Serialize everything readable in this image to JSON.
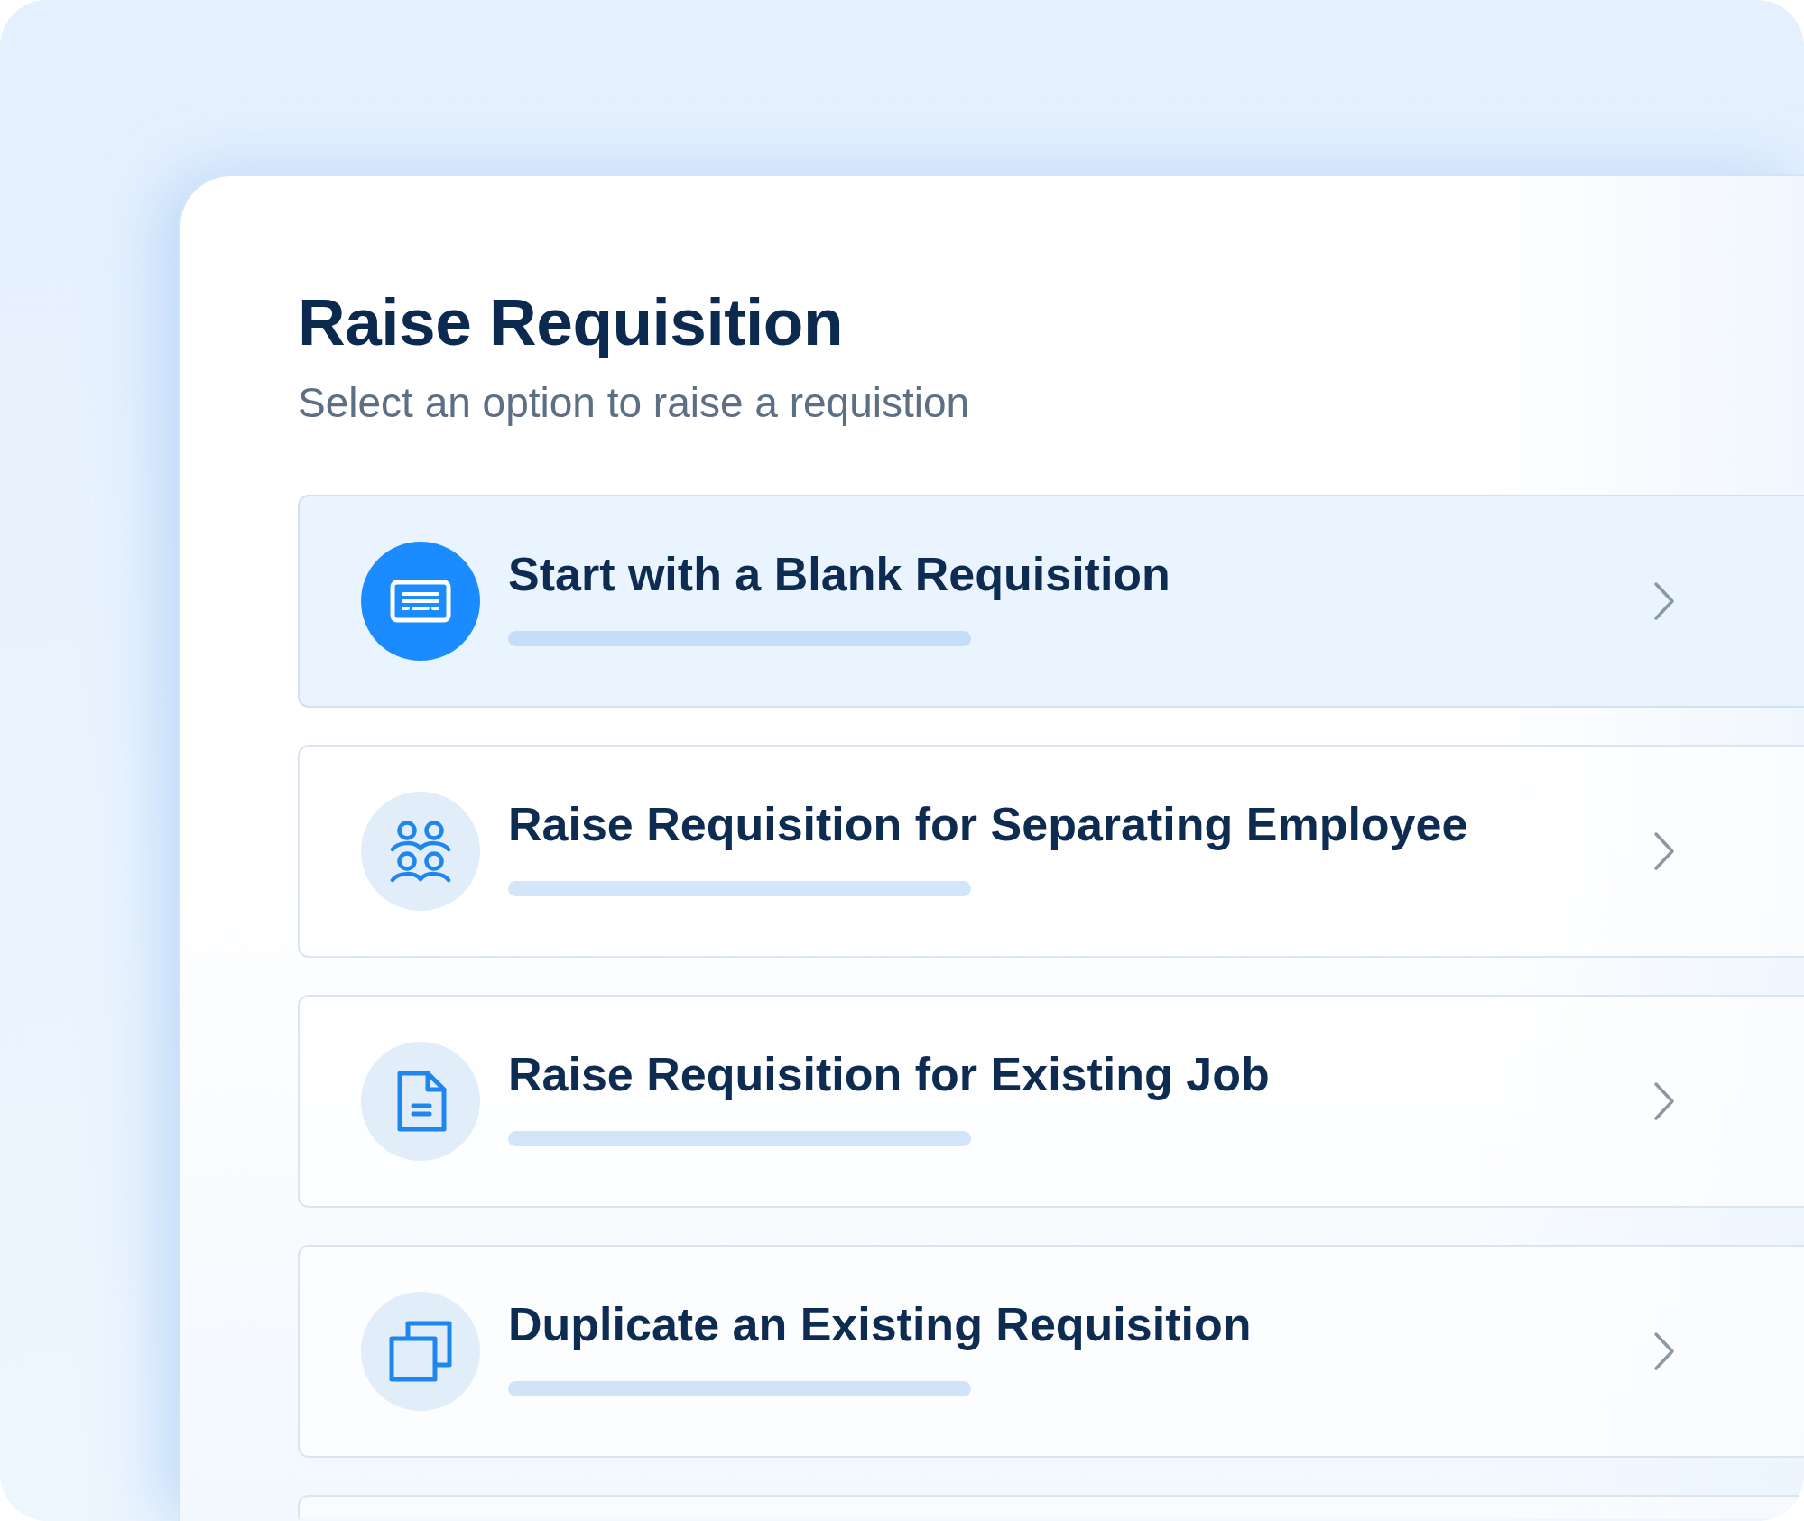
{
  "panel": {
    "title": "Raise Requisition",
    "subtitle": "Select an option to raise a requistion"
  },
  "options": [
    {
      "kind": "option",
      "title": "Start with a Blank Requisition",
      "selected": true
    },
    {
      "kind": "option",
      "title": "Raise Requisition for Separating Employee",
      "selected": false
    },
    {
      "kind": "option",
      "title": "Raise Requisition for Existing Job",
      "selected": false
    },
    {
      "kind": "option",
      "title": "Duplicate an Existing Requisition",
      "selected": false
    },
    {
      "kind": "clipped",
      "selected": false
    }
  ]
}
